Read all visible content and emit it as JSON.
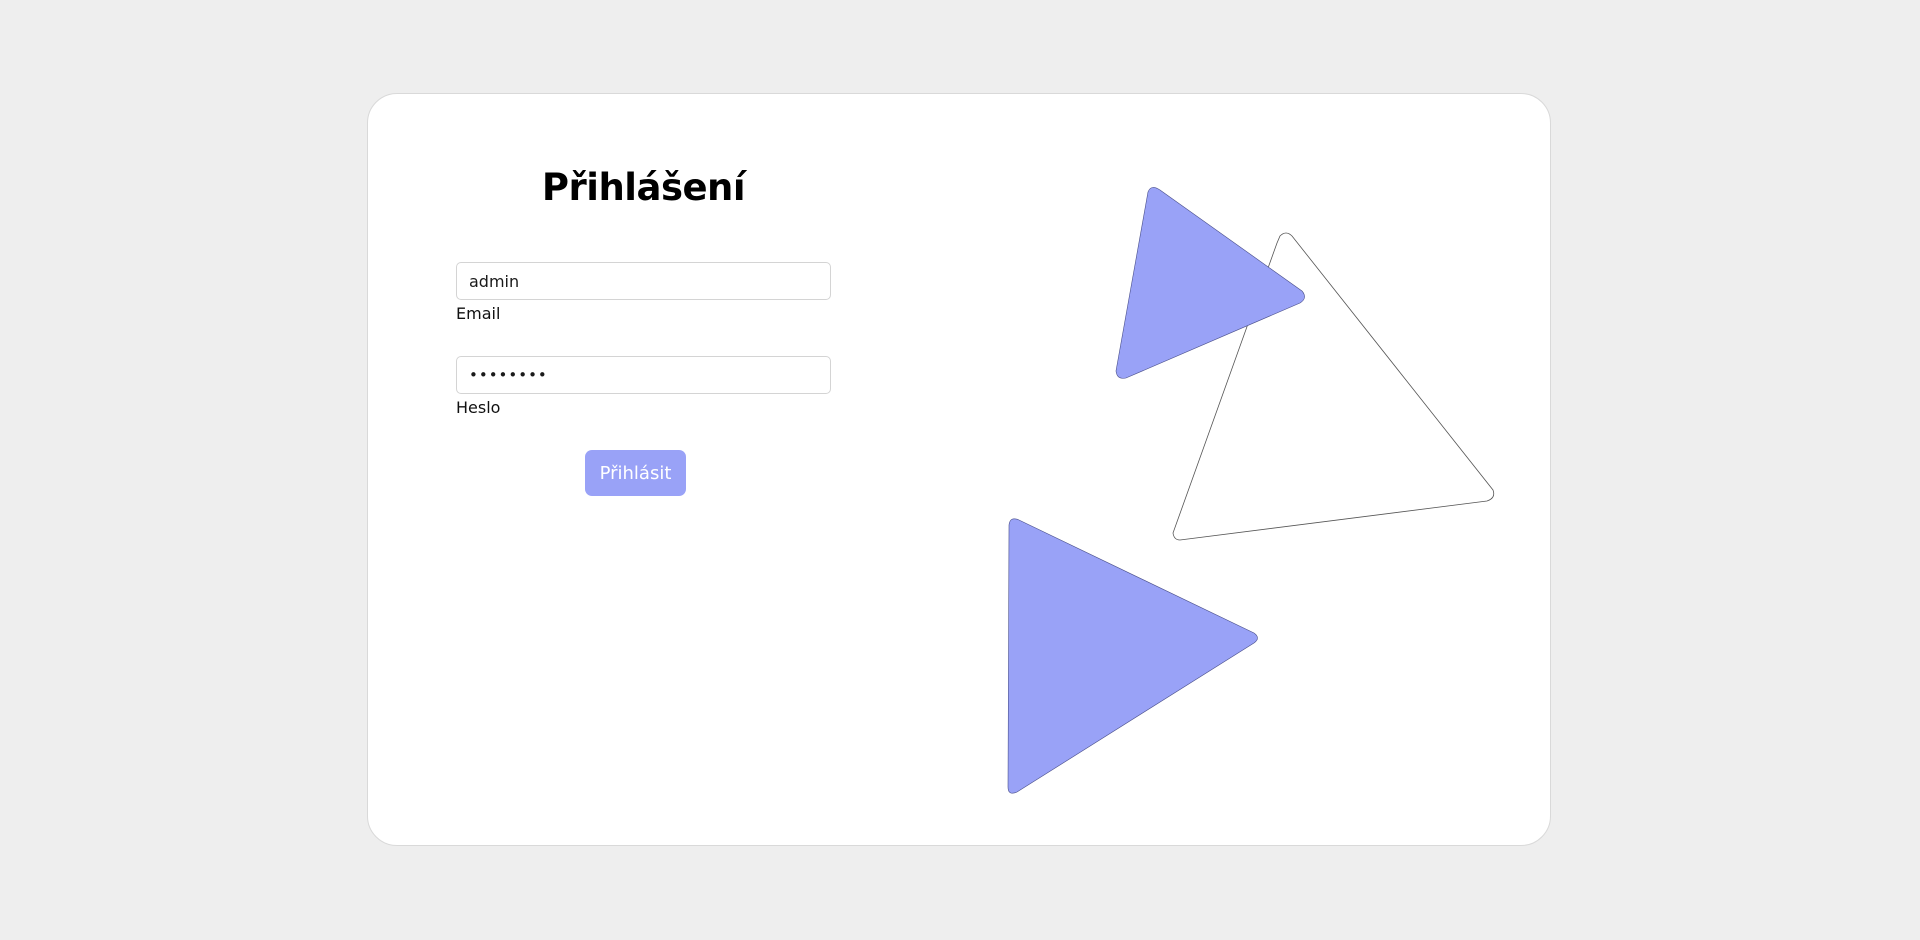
{
  "login": {
    "title": "Přihlášení",
    "email_value": "admin",
    "email_label": "Email",
    "password_value": "password",
    "password_label": "Heslo",
    "submit_label": "Přihlásit"
  },
  "colors": {
    "page_background": "#eeeeee",
    "card_background": "#ffffff",
    "accent": "#99a2f7",
    "outline_stroke": "#555555"
  },
  "decorations": [
    {
      "name": "filled-triangle-top",
      "style": "filled"
    },
    {
      "name": "outline-triangle",
      "style": "outline"
    },
    {
      "name": "filled-triangle-bottom",
      "style": "filled"
    }
  ]
}
